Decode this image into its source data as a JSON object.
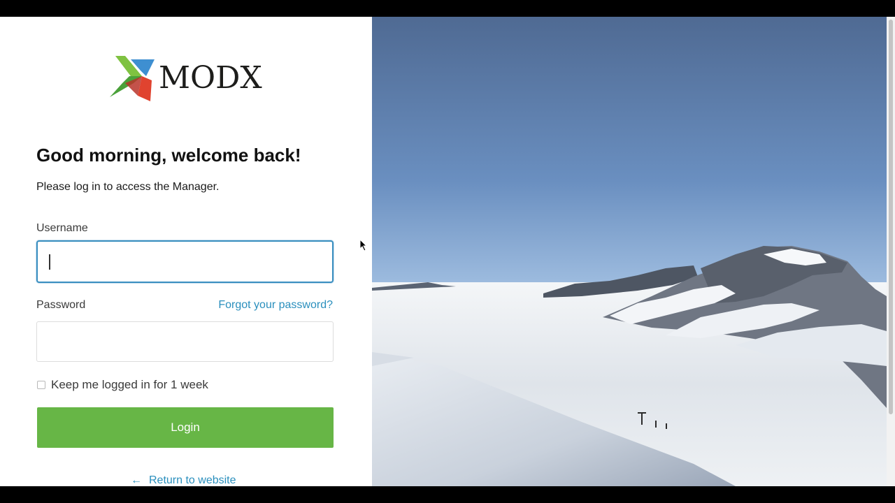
{
  "brand": {
    "name": "MODX"
  },
  "greeting": {
    "bold": "Good morning",
    "rest": ", welcome back!"
  },
  "intro": "Please log in to access the Manager.",
  "form": {
    "username_label": "Username",
    "username_value": "",
    "password_label": "Password",
    "password_value": "",
    "forgot_link": "Forgot your password?",
    "remember_label": "Keep me logged in for 1 week",
    "remember_checked": false,
    "login_button": "Login"
  },
  "footer": {
    "return_link": "Return to website",
    "return_icon": "arrow-left-icon"
  },
  "colors": {
    "accent_green": "#67b646",
    "link_blue": "#2a8fbd",
    "focus_border": "#3a8fc0"
  }
}
